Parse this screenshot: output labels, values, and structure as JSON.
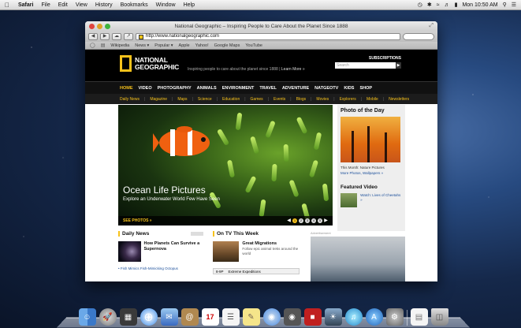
{
  "menubar": {
    "apple": "",
    "app": "Safari",
    "items": [
      "File",
      "Edit",
      "View",
      "History",
      "Bookmarks",
      "Window",
      "Help"
    ],
    "clock": "Mon 10:50 AM"
  },
  "window": {
    "title": "National Geographic – Inspiring People to Care About the Planet Since 1888",
    "url": "http://www.nationalgeographic.com",
    "bookmarks": [
      "Wikipedia",
      "News ▾",
      "Popular ▾",
      "Apple",
      "Yahoo!",
      "Google Maps",
      "YouTube"
    ]
  },
  "ng": {
    "logo_line1": "NATIONAL",
    "logo_line2": "GEOGRAPHIC",
    "tagline": "Inspiring people to care about the planet since 1888",
    "learn_more": "Learn More »",
    "subscriptions": "SUBSCRIPTIONS",
    "search_placeholder": "Search",
    "nav": [
      "HOME",
      "VIDEO",
      "PHOTOGRAPHY",
      "ANIMALS",
      "ENVIRONMENT",
      "TRAVEL",
      "ADVENTURE",
      "NATGEOTV",
      "KIDS",
      "SHOP"
    ],
    "subnav": [
      "Daily News",
      "Magazine",
      "Maps",
      "Science",
      "Education",
      "Games",
      "Events",
      "Blogs",
      "Movies",
      "Explorers",
      "Mobile",
      "Newsletters"
    ]
  },
  "hero": {
    "title": "Ocean Life Pictures",
    "subtitle": "Explore an Underwater World Few Have Seen",
    "see_photos": "SEE PHOTOS »",
    "dots": [
      "1",
      "2",
      "3",
      "4",
      "5"
    ]
  },
  "potd": {
    "heading": "Photo of the Day",
    "caption": "This Month: Nature Pictures",
    "link": "More Photos, Wallpapers »",
    "featured_heading": "Featured Video",
    "featured_text": "Watch: Lives of Cheetahs »"
  },
  "daily": {
    "heading": "Daily News",
    "item_title": "How Planets Can Survive a Supernova",
    "bullet": "• Fish Mimics Fish-Mimicking Octopus"
  },
  "ontv": {
    "heading": "On TV This Week",
    "item_title": "Great Migrations",
    "item_text": "Follow epic animal treks around the world",
    "row_time": "8-9P",
    "row_show": "Extreme Expeditions"
  },
  "ad": {
    "label": "Advertisement"
  },
  "dock_icons": [
    "finder-icon",
    "launchpad-icon",
    "mission-control-icon",
    "safari-icon",
    "mail-icon",
    "contacts-icon",
    "calendar-icon",
    "reminders-icon",
    "notes-icon",
    "messages-icon",
    "facetime-icon",
    "photo-booth-icon",
    "iphoto-icon",
    "itunes-icon",
    "app-store-icon",
    "system-preferences-icon",
    "documents-icon",
    "trash-icon"
  ],
  "calendar_day": "17"
}
